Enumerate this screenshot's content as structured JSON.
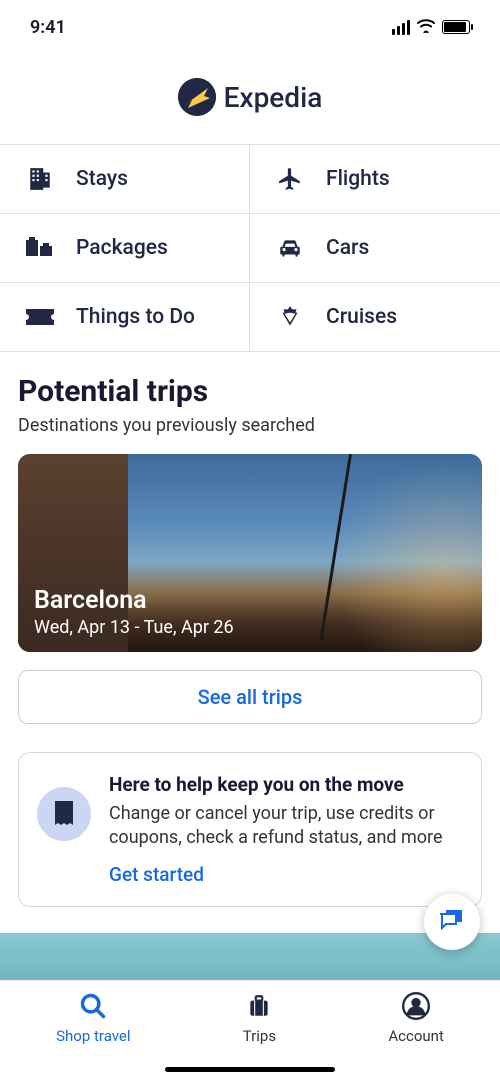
{
  "status": {
    "time": "9:41"
  },
  "brand": {
    "name": "Expedia"
  },
  "lob": {
    "stays": "Stays",
    "flights": "Flights",
    "packages": "Packages",
    "cars": "Cars",
    "things": "Things to Do",
    "cruises": "Cruises"
  },
  "potential": {
    "title": "Potential trips",
    "subtitle": "Destinations you previously searched",
    "trip": {
      "name": "Barcelona",
      "dates": "Wed, Apr 13 - Tue, Apr 26"
    },
    "see_all": "See all trips"
  },
  "help": {
    "title": "Here to help keep you on the move",
    "body": "Change or cancel your trip, use credits or coupons, check a refund status, and more",
    "cta": "Get started"
  },
  "tabs": {
    "shop": "Shop travel",
    "trips": "Trips",
    "account": "Account"
  }
}
